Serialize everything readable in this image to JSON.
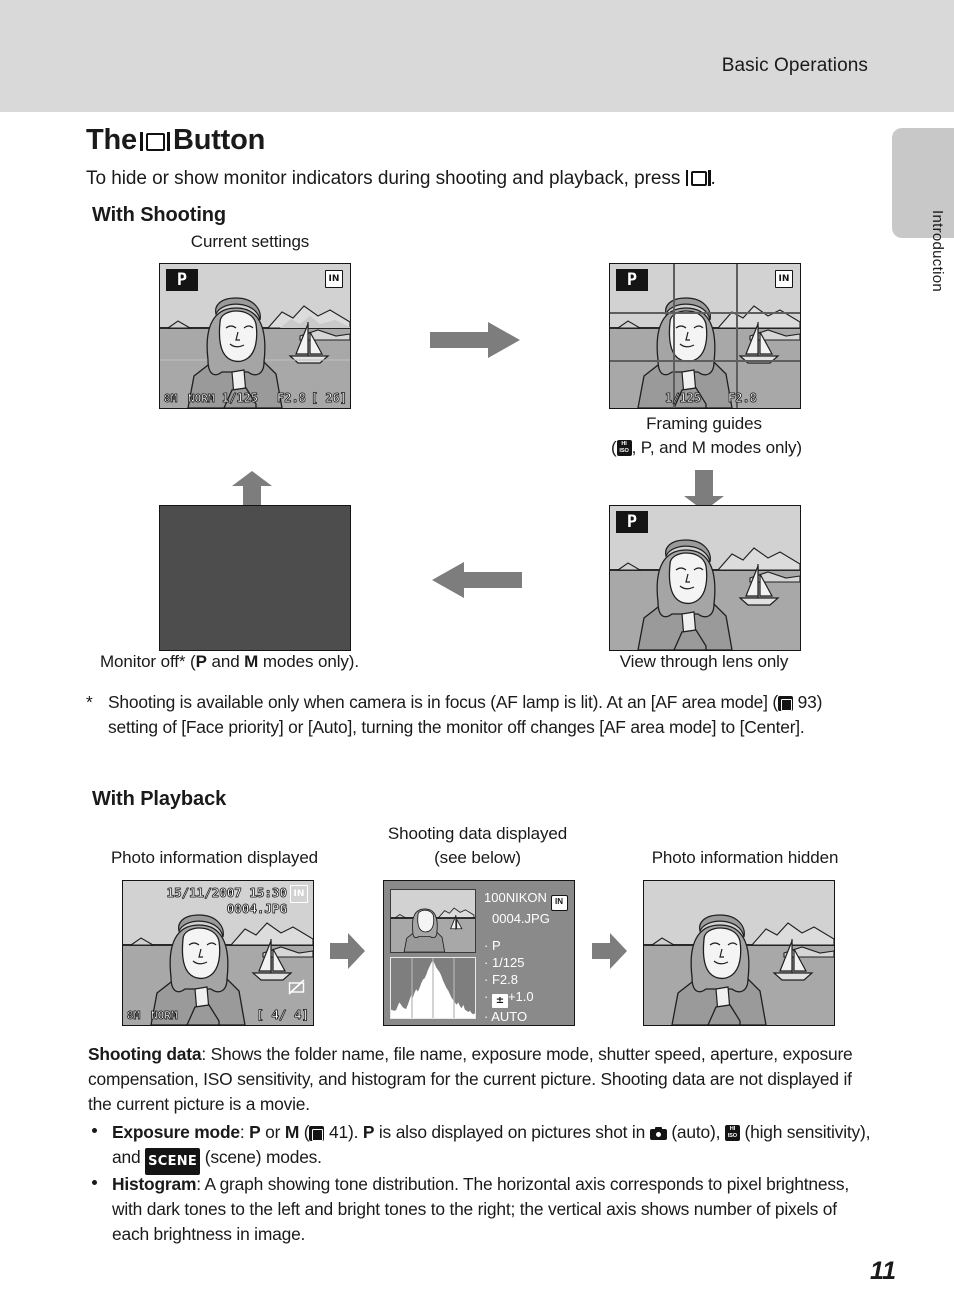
{
  "header": {
    "title": "Basic Operations",
    "side_tab_label": "Introduction"
  },
  "page": {
    "heading_before": "The",
    "heading_after": "Button",
    "heading_icon": "monitor-button-icon",
    "lead_before": "To hide or show monitor indicators during shooting and playback, press",
    "lead_after": ".",
    "page_number": "11"
  },
  "shooting": {
    "section_title": "With Shooting",
    "caption_current": "Current settings",
    "caption_framing_line1": "Framing guides",
    "caption_framing_line2_pre": "(",
    "caption_framing_hiso": "HI ISO",
    "caption_framing_line2_post": ", P, and M modes only)",
    "caption_lens_only": "View through lens only",
    "caption_monitor_off": "Monitor off* (P and M modes only).",
    "footnote_marker": "*",
    "footnote_text": "Shooting is available only when camera is in focus (AF lamp is lit). At an [AF area mode] (❐ 93) setting of [Face priority] or [Auto], turning the monitor off changes [AF area mode] to [Center].",
    "footnote_ref_page": "93",
    "screen_current": {
      "mode": "P",
      "memory": "IN",
      "image_size": "8M",
      "quality": "NORM",
      "shutter": "1/125",
      "aperture": "F2.8",
      "shots_remaining": "[    26]"
    },
    "screen_framing": {
      "mode": "P",
      "memory": "IN",
      "shutter": "1/125",
      "aperture": "F2.8"
    },
    "screen_lens_only": {
      "mode": "P"
    }
  },
  "playback": {
    "section_title": "With Playback",
    "caption_photo_info": "Photo information displayed",
    "caption_shooting_data_l1": "Shooting data displayed",
    "caption_shooting_data_l2": "(see below)",
    "caption_hidden": "Photo information hidden",
    "screen_photo_info": {
      "datetime": "15/11/2007 15:30",
      "memory": "IN",
      "filename": "0004.JPG",
      "image_size": "8M",
      "quality": "NORM",
      "frame_counter": "[   4/    4]"
    },
    "screen_shooting_data": {
      "folder": "100NIKON",
      "memory": "IN",
      "filename": "0004.JPG",
      "rows": [
        "P",
        "1/125",
        "F2.8",
        "+1.0",
        "AUTO"
      ],
      "exposure_comp_icon": "exposure-compensation-icon"
    }
  },
  "body": {
    "shooting_data_label": "Shooting data",
    "shooting_data_text": ": Shows the folder name, file name, exposure mode, shutter speed, aperture, exposure compensation, ISO sensitivity, and histogram for the current picture. Shooting data are not displayed if the current picture is a movie.",
    "bullet1_label": "Exposure mode",
    "bullet1_part1": ": P or M (",
    "bullet1_ref": "41",
    "bullet1_part2": "). P is also displayed on pictures shot in",
    "bullet1_auto": "(auto),",
    "bullet1_hiso": "(high sensitivity), and",
    "bullet1_scene_label": "SCENE",
    "bullet1_part3": "(scene) modes.",
    "bullet2_label": "Histogram",
    "bullet2_text": ": A graph showing tone distribution. The horizontal axis corresponds to pixel brightness, with dark tones to the left and bright tones to the right; the vertical axis shows number of pixels of each brightness in image."
  },
  "chart_data": {
    "type": "bar",
    "title": "Histogram",
    "xlabel": "pixel brightness",
    "ylabel": "number of pixels",
    "grid": true,
    "gridlines": 3,
    "values": [
      14,
      13,
      12,
      13,
      20,
      26,
      22,
      18,
      16,
      15,
      22,
      30,
      38,
      34,
      42,
      48,
      44,
      50,
      58,
      64,
      70,
      66,
      72,
      80,
      86,
      92,
      96,
      90,
      84,
      80,
      76,
      70,
      62,
      56,
      50,
      46,
      40,
      34,
      30,
      26,
      22,
      26,
      20,
      16,
      22,
      14,
      12,
      10,
      12,
      8
    ]
  },
  "colors": {
    "header_band": "#d9d9d9",
    "side_tab": "#c8c8c8",
    "arrow": "#7d7d7d",
    "screen_off": "#4d4d4d",
    "osd_text": "#ffffff"
  }
}
